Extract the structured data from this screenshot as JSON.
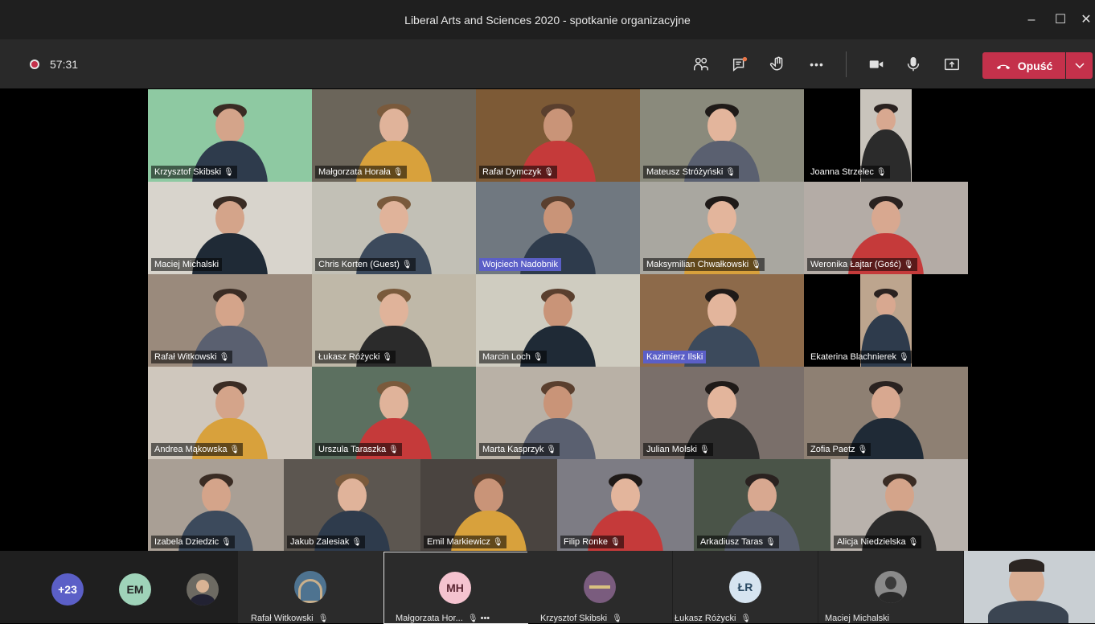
{
  "window": {
    "title": "Liberal Arts and Sciences 2020 - spotkanie organizacyjne",
    "minimize": "–",
    "maximize": "☐",
    "close": "✕"
  },
  "toolbar": {
    "timer": "57:31",
    "leave_label": "Opuść",
    "more": "•••"
  },
  "participants": [
    {
      "name": "Krzysztof Skibski",
      "mic": true,
      "hl": false
    },
    {
      "name": "Małgorzata Horała",
      "mic": true,
      "hl": false
    },
    {
      "name": "Rafał Dymczyk",
      "mic": true,
      "hl": false
    },
    {
      "name": "Mateusz Stróżyński",
      "mic": true,
      "hl": false
    },
    {
      "name": "Joanna Strzelec",
      "mic": true,
      "hl": false
    },
    {
      "name": "Maciej Michalski",
      "mic": false,
      "hl": false
    },
    {
      "name": "Chris Korten (Guest)",
      "mic": true,
      "hl": false
    },
    {
      "name": "Wojciech Nadobnik",
      "mic": false,
      "hl": true
    },
    {
      "name": "Maksymilian Chwałkowski",
      "mic": true,
      "hl": false
    },
    {
      "name": "Weronika Łajtar (Gość)",
      "mic": true,
      "hl": false
    },
    {
      "name": "Rafał Witkowski",
      "mic": true,
      "hl": false
    },
    {
      "name": "Łukasz Różycki",
      "mic": true,
      "hl": false
    },
    {
      "name": "Marcin Loch",
      "mic": true,
      "hl": false
    },
    {
      "name": "Kazimierz Ilski",
      "mic": false,
      "hl": true
    },
    {
      "name": "Ekaterina Blachnierek",
      "mic": true,
      "hl": false
    },
    {
      "name": "Andrea Mąkowska",
      "mic": true,
      "hl": false
    },
    {
      "name": "Urszula Taraszka",
      "mic": true,
      "hl": false
    },
    {
      "name": "Marta Kasprzyk",
      "mic": true,
      "hl": false
    },
    {
      "name": "Julian Molski",
      "mic": true,
      "hl": false
    },
    {
      "name": "Zofia Paetz",
      "mic": true,
      "hl": false
    },
    {
      "name": "Izabela Dziedzic",
      "mic": true,
      "hl": false
    },
    {
      "name": "Jakub Zalesiak",
      "mic": true,
      "hl": false
    },
    {
      "name": "Emil Markiewicz",
      "mic": true,
      "hl": false
    },
    {
      "name": "Filip Ronke",
      "mic": true,
      "hl": false
    },
    {
      "name": "Arkadiusz Taras",
      "mic": true,
      "hl": false
    },
    {
      "name": "Alicja Niedzielska",
      "mic": true,
      "hl": false
    }
  ],
  "bottom": {
    "overflow_count": "+23",
    "em_initials": "EM",
    "tiles": [
      {
        "name": "Rafał Witkowski",
        "mic": true
      },
      {
        "name": "Małgorzata Hor...",
        "mic": true,
        "initials": "MH",
        "more": "•••"
      },
      {
        "name": "Krzysztof Skibski",
        "mic": true
      },
      {
        "name": "Łukasz Różycki",
        "mic": true,
        "initials": "ŁR"
      },
      {
        "name": "Maciej Michalski",
        "mic": false
      }
    ]
  },
  "colors": {
    "accent": "#5b5fc7",
    "leave": "#c4314b",
    "titlebar": "#1f1f1f",
    "toolbar": "#292929"
  }
}
